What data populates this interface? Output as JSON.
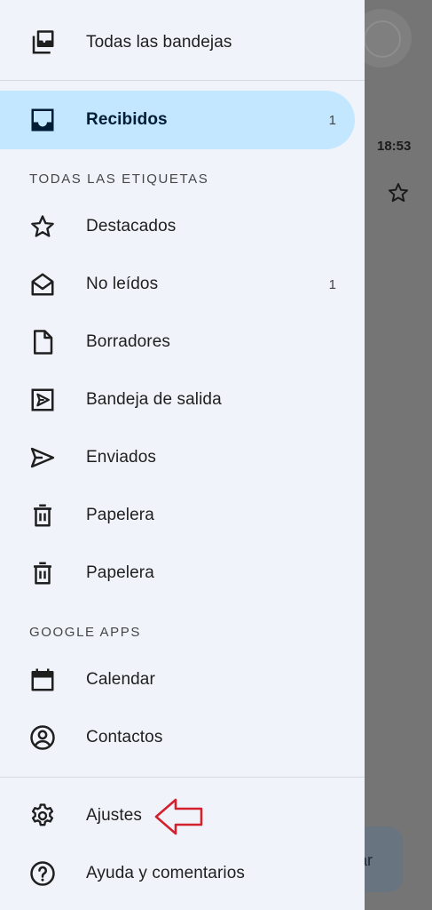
{
  "background": {
    "time": "18:53",
    "fab_label": "ar"
  },
  "drawer": {
    "all_inboxes": {
      "label": "Todas las bandejas",
      "icon": "all-inboxes-icon"
    },
    "inbox": {
      "label": "Recibidos",
      "count": "1",
      "icon": "inbox-icon"
    },
    "labels_section_title": "TODAS LAS ETIQUETAS",
    "labels": [
      {
        "label": "Destacados",
        "count": "",
        "icon": "star-icon"
      },
      {
        "label": "No leídos",
        "count": "1",
        "icon": "unread-mail-icon"
      },
      {
        "label": "Borradores",
        "count": "",
        "icon": "draft-icon"
      },
      {
        "label": "Bandeja de salida",
        "count": "",
        "icon": "outbox-icon"
      },
      {
        "label": "Enviados",
        "count": "",
        "icon": "send-icon"
      },
      {
        "label": "Papelera",
        "count": "",
        "icon": "trash-icon"
      },
      {
        "label": "Papelera",
        "count": "",
        "icon": "trash-icon"
      }
    ],
    "apps_section_title": "GOOGLE APPS",
    "apps": [
      {
        "label": "Calendar",
        "icon": "calendar-icon"
      },
      {
        "label": "Contactos",
        "icon": "contacts-icon"
      }
    ],
    "footer": [
      {
        "label": "Ajustes",
        "icon": "gear-icon"
      },
      {
        "label": "Ayuda y comentarios",
        "icon": "help-icon"
      }
    ]
  },
  "colors": {
    "drawer_bg": "#f0f3fa",
    "selected_bg": "#c2e7ff",
    "annotation_arrow": "#d3212d"
  }
}
